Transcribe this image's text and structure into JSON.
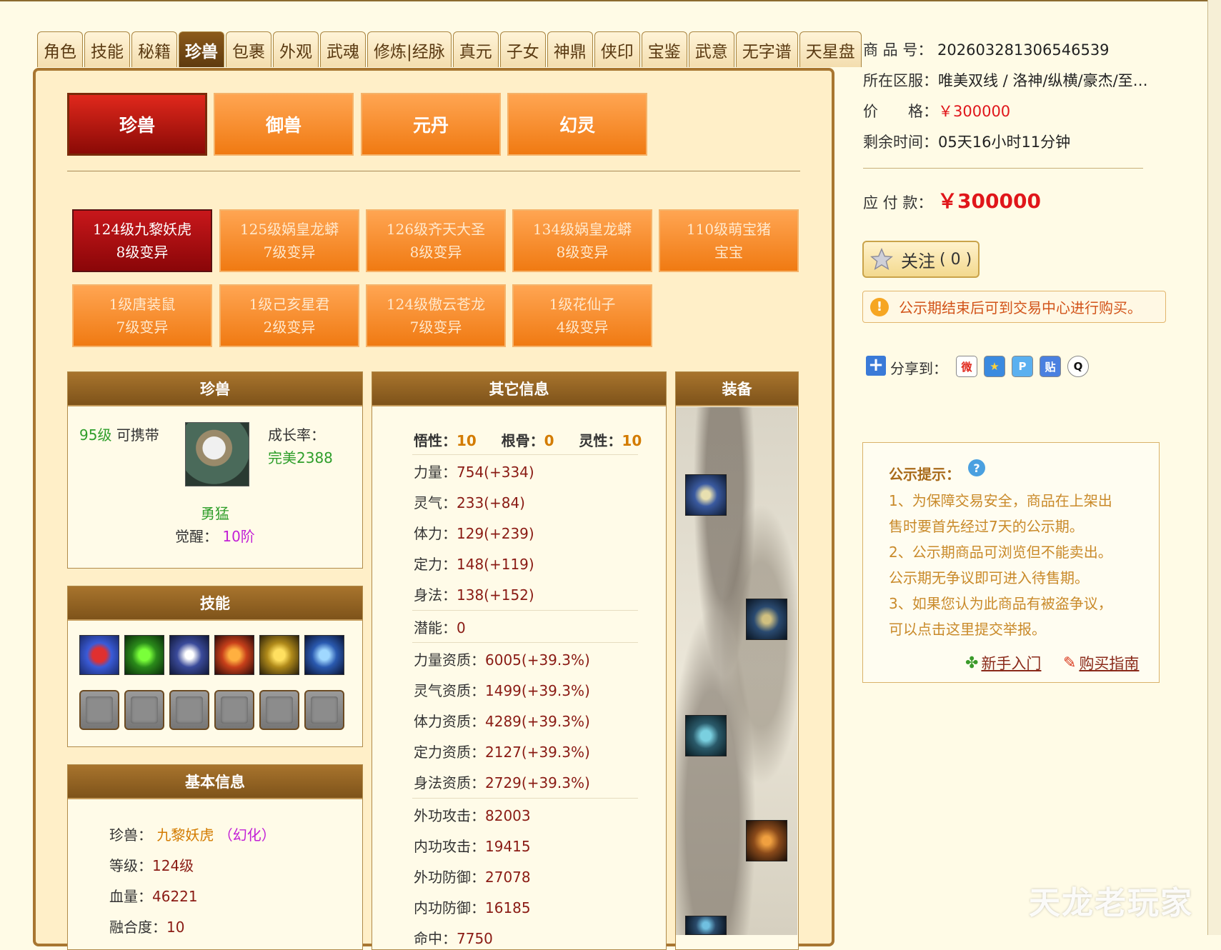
{
  "main_tabs": [
    "角色",
    "技能",
    "秘籍",
    "珍兽",
    "包裹",
    "外观",
    "武魂",
    "修炼|经脉",
    "真元",
    "子女",
    "神鼎",
    "侠印",
    "宝鉴",
    "武意",
    "无字谱",
    "天星盘"
  ],
  "active_main_tab": "珍兽",
  "sub_tabs": [
    "珍兽",
    "御兽",
    "元丹",
    "幻灵"
  ],
  "pets": [
    {
      "line1": "124级九黎妖虎",
      "line2": "8级变异"
    },
    {
      "line1": "125级娲皇龙蟒",
      "line2": "7级变异"
    },
    {
      "line1": "126级齐天大圣",
      "line2": "8级变异"
    },
    {
      "line1": "134级娲皇龙蟒",
      "line2": "8级变异"
    },
    {
      "line1": "110级萌宝猪",
      "line2": "宝宝"
    },
    {
      "line1": "1级唐装鼠",
      "line2": "7级变异"
    },
    {
      "line1": "1级己亥星君",
      "line2": "2级变异"
    },
    {
      "line1": "124级傲云苍龙",
      "line2": "7级变异"
    },
    {
      "line1": "1级花仙子",
      "line2": "4级变异"
    }
  ],
  "pet_box": {
    "title": "珍兽",
    "level": "95级",
    "carry": "可携带",
    "growth_label": "成长率：",
    "growth_value": "完美2388",
    "temper": "勇猛",
    "awaken_label": "觉醒：",
    "awaken_value": "10阶"
  },
  "skills_box": {
    "title": "技能"
  },
  "basic_box": {
    "title": "基本信息",
    "pet_label": "珍兽：",
    "pet_name": "九黎妖虎",
    "pet_form": "（幻化）",
    "level_label": "等级：",
    "level_value": "124级",
    "hp_label": "血量：",
    "hp_value": "46221",
    "fusion_label": "融合度：",
    "fusion_value": "10"
  },
  "other_box": {
    "title": "其它信息",
    "top": [
      {
        "label": "悟性：",
        "value": "10"
      },
      {
        "label": "根骨：",
        "value": "0"
      },
      {
        "label": "灵性：",
        "value": "10"
      }
    ],
    "stats": [
      {
        "label": "力量：",
        "value": "754(+334)"
      },
      {
        "label": "灵气：",
        "value": "233(+84)"
      },
      {
        "label": "体力：",
        "value": "129(+239)"
      },
      {
        "label": "定力：",
        "value": "148(+119)"
      },
      {
        "label": "身法：",
        "value": "138(+152)"
      },
      {
        "label": "潜能：",
        "value": "0"
      },
      {
        "label": "力量资质：",
        "value": "6005(+39.3%)"
      },
      {
        "label": "灵气资质：",
        "value": "1499(+39.3%)"
      },
      {
        "label": "体力资质：",
        "value": "4289(+39.3%)"
      },
      {
        "label": "定力资质：",
        "value": "2127(+39.3%)"
      },
      {
        "label": "身法资质：",
        "value": "2729(+39.3%)"
      },
      {
        "label": "外功攻击：",
        "value": "82003"
      },
      {
        "label": "内功攻击：",
        "value": "19415"
      },
      {
        "label": "外功防御：",
        "value": "27078"
      },
      {
        "label": "内功防御：",
        "value": "16185"
      },
      {
        "label": "命中：",
        "value": "7750"
      }
    ]
  },
  "equip_box": {
    "title": "装备"
  },
  "product": {
    "id_label": "商 品 号：",
    "id_value": "202603281306546539",
    "server_label": "所在区服：",
    "server_value": "唯美双线 / 洛神/纵横/豪杰/至…",
    "price_label": "价　　格：",
    "price_value": "￥300000",
    "remain_label": "剩余时间：",
    "remain_value": "05天16小时11分钟",
    "pay_label": "应 付 款：",
    "pay_value": "￥300000"
  },
  "follow": {
    "label": "关注",
    "count": "( 0 )"
  },
  "notice": "公示期结束后可到交易中心进行购买。",
  "share_label": "分享到：",
  "share_icons": [
    "weibo-icon",
    "qzone-icon",
    "pengyou-icon",
    "tieba-icon",
    "qq-icon"
  ],
  "tips": {
    "title": "公示提示：",
    "lines": [
      "1、为保障交易安全，商品在上架出",
      "售时要首先经过7天的公示期。",
      "2、公示期商品可浏览但不能卖出。",
      "公示期无争议即可进入待售期。",
      "3、如果您认为此商品有被盗争议，",
      "可以点击这里提交举报。"
    ],
    "link_newbie": "新手入门",
    "link_guide": "购买指南"
  },
  "watermark": "天龙老玩家",
  "colors": {
    "tab_orange": "#f07a12",
    "tab_active_red": "#8a0608",
    "header_brown": "#8b5a1c",
    "price_red": "#e0161a"
  }
}
